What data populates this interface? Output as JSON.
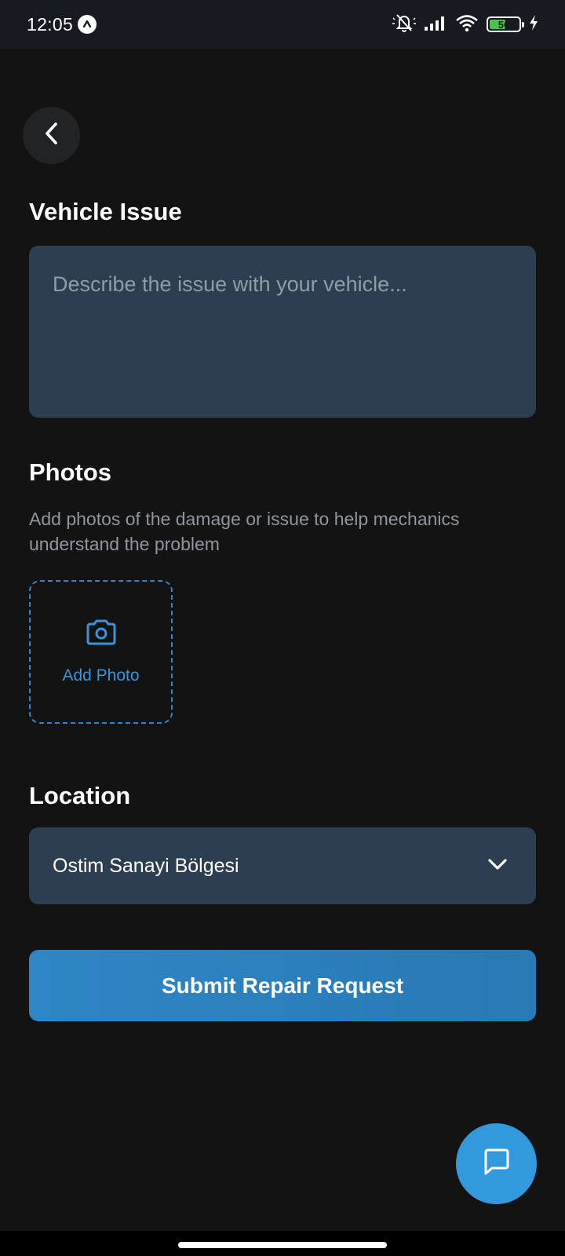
{
  "status_bar": {
    "time": "12:05",
    "battery_level": "56",
    "battery_fraction": 0.56,
    "icons": [
      "app-notification-icon",
      "mute-icon",
      "signal-icon",
      "wifi-icon",
      "battery-icon",
      "charging-icon"
    ]
  },
  "header": {
    "back_icon": "chevron-left-icon"
  },
  "vehicle_issue": {
    "title": "Vehicle Issue",
    "value": "",
    "placeholder": "Describe the issue with your vehicle..."
  },
  "photos": {
    "title": "Photos",
    "description": "Add photos of the damage or issue to help mechanics understand the problem",
    "add_label": "Add Photo",
    "add_icon": "camera-icon"
  },
  "location": {
    "title": "Location",
    "selected": "Ostim Sanayi Bölgesi",
    "dropdown_icon": "chevron-down-icon"
  },
  "submit": {
    "label": "Submit Repair Request"
  },
  "fab": {
    "icon": "chat-icon"
  },
  "colors": {
    "background": "#131314",
    "input_background": "#2e3e51",
    "accent": "#2f86c6",
    "fab": "#3399dd",
    "battery_green": "#4cc24a"
  }
}
